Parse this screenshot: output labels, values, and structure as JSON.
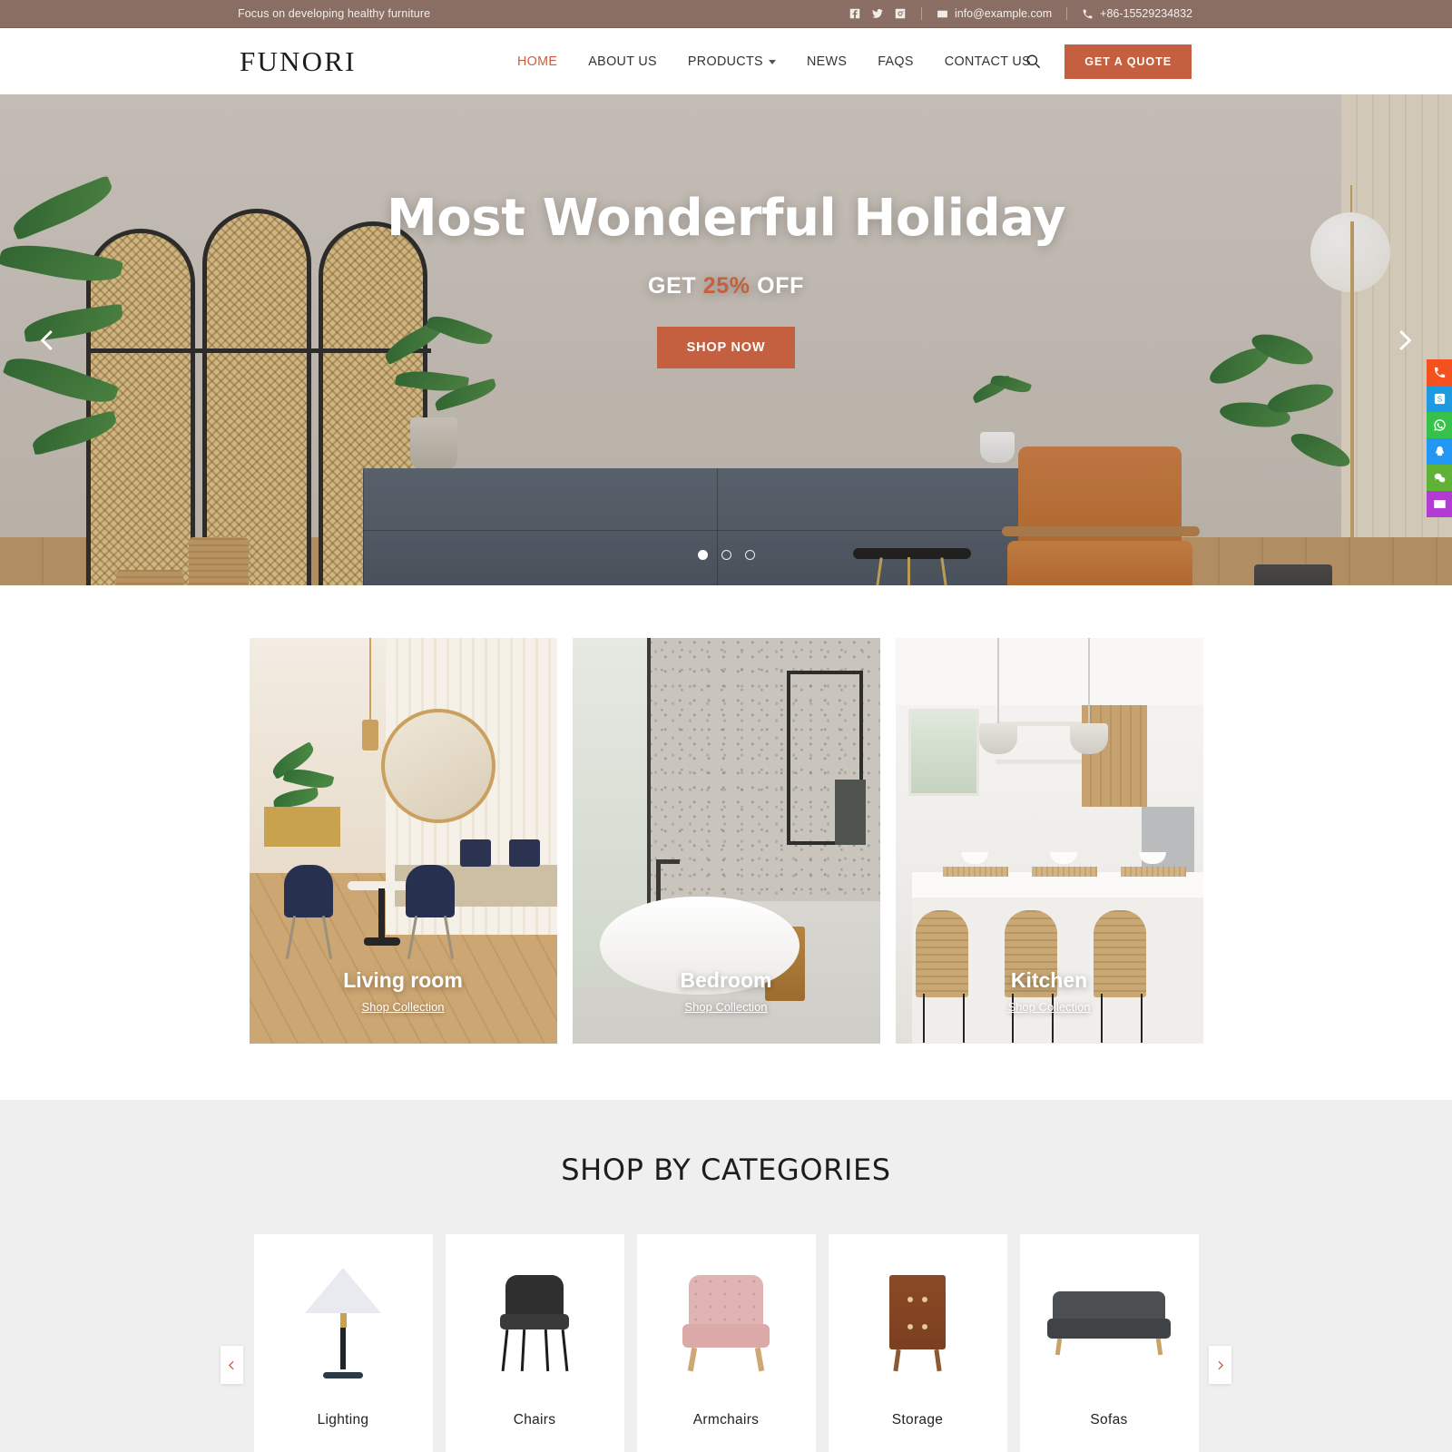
{
  "topbar": {
    "slogan": "Focus on developing healthy furniture",
    "social": [
      {
        "name": "facebook-icon",
        "label": "Facebook"
      },
      {
        "name": "twitter-icon",
        "label": "Twitter"
      },
      {
        "name": "instagram-icon",
        "label": "Instagram"
      }
    ],
    "email": "info@example.com",
    "phone": "+86-15529234832"
  },
  "header": {
    "logo": "FUNORI",
    "nav": [
      {
        "label": "HOME",
        "active": true,
        "dropdown": false
      },
      {
        "label": "ABOUT US",
        "active": false,
        "dropdown": false
      },
      {
        "label": "PRODUCTS",
        "active": false,
        "dropdown": true
      },
      {
        "label": "NEWS",
        "active": false,
        "dropdown": false
      },
      {
        "label": "FAQS",
        "active": false,
        "dropdown": false
      },
      {
        "label": "CONTACT US",
        "active": false,
        "dropdown": false
      }
    ],
    "search_label": "Search",
    "quote_label": "GET A QUOTE"
  },
  "hero": {
    "title": "Most Wonderful Holiday",
    "sub_before": "GET ",
    "sub_percent": "25%",
    "sub_after": " OFF",
    "cta_label": "SHOP NOW",
    "prev_label": "Previous slide",
    "next_label": "Next slide",
    "slides": 3,
    "active_slide": 1
  },
  "rooms": [
    {
      "label": "Living room",
      "link": "Shop Collection"
    },
    {
      "label": "Bedroom",
      "link": "Shop Collection"
    },
    {
      "label": "Kitchen",
      "link": "Shop Collection"
    }
  ],
  "categories": {
    "title": "SHOP BY CATEGORIES",
    "prev_label": "Previous",
    "next_label": "Next",
    "items": [
      {
        "label": "Lighting",
        "icon": "table-lamp-thumb"
      },
      {
        "label": "Chairs",
        "icon": "dining-chair-thumb"
      },
      {
        "label": "Armchairs",
        "icon": "armchair-thumb"
      },
      {
        "label": "Storage",
        "icon": "dresser-thumb"
      },
      {
        "label": "Sofas",
        "icon": "sofa-thumb"
      }
    ]
  },
  "rail": [
    {
      "name": "phone-icon",
      "label": "Phone",
      "color": "#F4511E"
    },
    {
      "name": "skype-icon",
      "label": "Skype",
      "color": "#1E9AE0"
    },
    {
      "name": "whatsapp-icon",
      "label": "WhatsApp",
      "color": "#36C24A"
    },
    {
      "name": "qq-icon",
      "label": "QQ",
      "color": "#2196F3"
    },
    {
      "name": "wechat-icon",
      "label": "WeChat",
      "color": "#5FB236"
    },
    {
      "name": "email-icon",
      "label": "Email",
      "color": "#B23BD4"
    }
  ],
  "colors": {
    "accent": "#C4603F",
    "topbar_bg": "#8B6E63",
    "section_bg": "#EFEFEF"
  }
}
